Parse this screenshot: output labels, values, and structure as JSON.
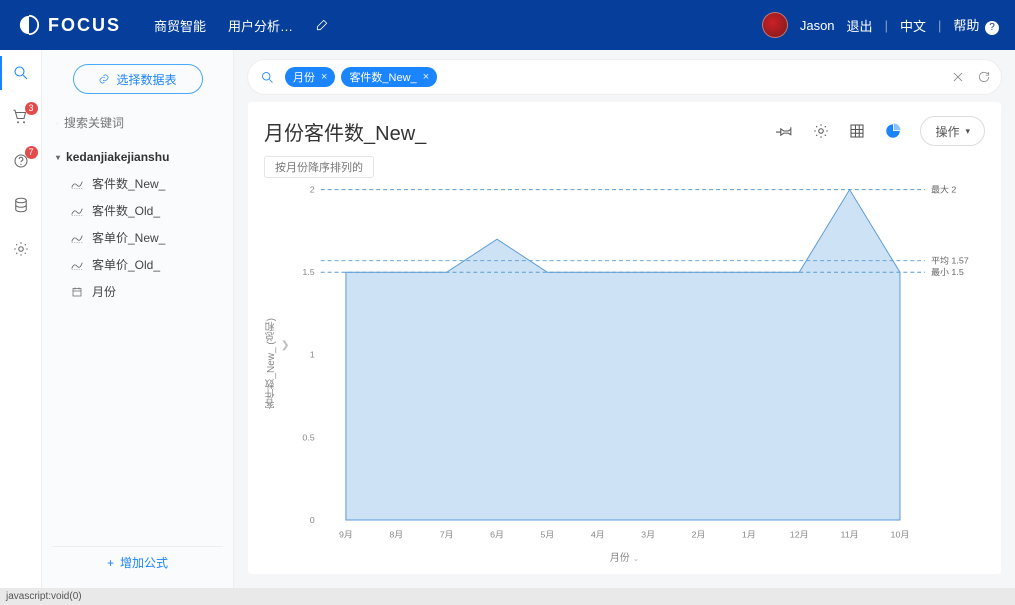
{
  "brand": {
    "name": "FOCUS"
  },
  "topnav": {
    "items": [
      "商贸智能",
      "用户分析…"
    ],
    "user": "Jason",
    "logout": "退出",
    "lang": "中文",
    "help": "帮助"
  },
  "rail": {
    "badges": {
      "cart": "3",
      "assist": "7"
    }
  },
  "sidebar": {
    "select_ds": "选择数据表",
    "search_placeholder": "搜索关键词",
    "dataset": "kedanjiakejianshu",
    "fields": [
      {
        "icon": "measure",
        "label": "客件数_New_"
      },
      {
        "icon": "measure",
        "label": "客件数_Old_"
      },
      {
        "icon": "measure",
        "label": "客单价_New_"
      },
      {
        "icon": "measure",
        "label": "客单价_Old_"
      },
      {
        "icon": "date",
        "label": "月份"
      }
    ],
    "add_formula": "增加公式"
  },
  "query": {
    "chips": [
      {
        "label": "月份"
      },
      {
        "label": "客件数_New_"
      }
    ]
  },
  "card": {
    "title": "月份客件数_New_",
    "sort_tag": "按月份降序排列的",
    "ops": "操作"
  },
  "chart_data": {
    "type": "area",
    "categories": [
      "9月",
      "8月",
      "7月",
      "6月",
      "5月",
      "4月",
      "3月",
      "2月",
      "1月",
      "12月",
      "11月",
      "10月"
    ],
    "values": [
      1.5,
      1.5,
      1.5,
      1.7,
      1.5,
      1.5,
      1.5,
      1.5,
      1.5,
      1.5,
      2.0,
      1.5
    ],
    "ylabel": "客件数_New_ (总和)",
    "xlabel": "月份",
    "ylim": [
      0,
      2
    ],
    "yticks": [
      0,
      0.5,
      1,
      1.5,
      2
    ],
    "annotations": {
      "max": {
        "label": "最大 2",
        "value": 2.0
      },
      "mean": {
        "label": "平均 1.57",
        "value": 1.57
      },
      "min": {
        "label": "最小 1.5",
        "value": 1.5
      }
    }
  },
  "statusbar": {
    "text": "javascript:void(0)"
  }
}
